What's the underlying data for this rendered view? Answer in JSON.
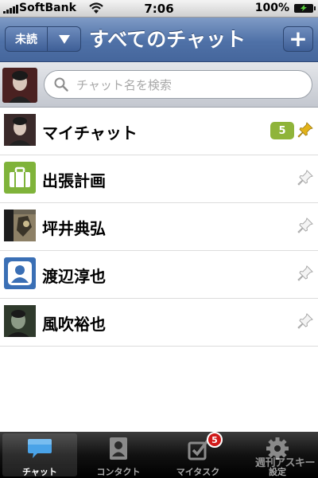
{
  "status_bar": {
    "carrier": "SoftBank",
    "time": "7:06",
    "battery": "100%"
  },
  "nav": {
    "filter_label": "未読",
    "title": "すべてのチャット",
    "add_label": "+"
  },
  "search": {
    "placeholder": "チャット名を検索"
  },
  "chats": [
    {
      "name": "マイチャット",
      "badge": "5",
      "pinned": true
    },
    {
      "name": "出張計画",
      "pinned": false
    },
    {
      "name": "坪井典弘",
      "pinned": false
    },
    {
      "name": "渡辺淳也",
      "pinned": false
    },
    {
      "name": "風吹裕也",
      "pinned": false
    }
  ],
  "tabs": [
    {
      "label": "チャット",
      "icon": "chat-bubble-icon",
      "selected": true
    },
    {
      "label": "コンタクト",
      "icon": "contact-icon",
      "selected": false
    },
    {
      "label": "マイタスク",
      "icon": "task-checkbox-icon",
      "selected": false,
      "badge": "5"
    },
    {
      "label": "設定",
      "icon": "gear-icon",
      "selected": false
    }
  ],
  "watermark": "週刊アスキー",
  "colors": {
    "nav": "#4f71a7",
    "badge_green": "#8fb43a",
    "pin_active": "#e2b21a",
    "tab_badge": "#d01b1b"
  }
}
